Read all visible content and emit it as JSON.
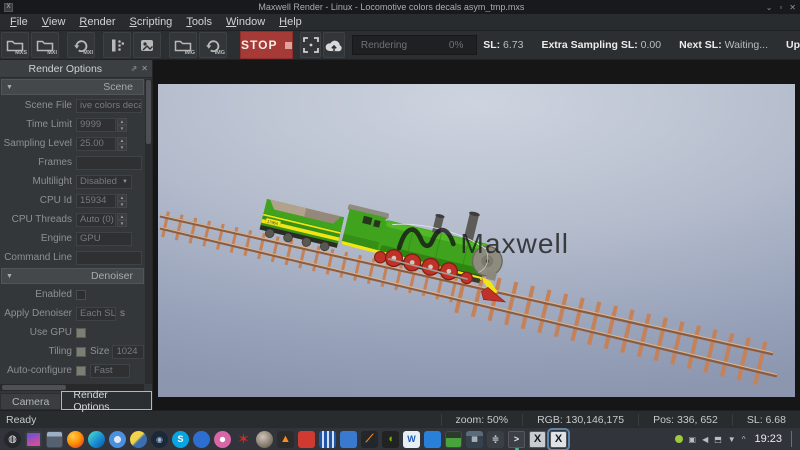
{
  "titlebar": {
    "title": "Maxwell Render - Linux - Locomotive colors decals asym_tmp.mxs",
    "minimize": "⌄",
    "maximize": "▫",
    "close": "✕"
  },
  "menubar": {
    "items": [
      "File",
      "View",
      "Render",
      "Scripting",
      "Tools",
      "Window",
      "Help"
    ]
  },
  "toolbar": {
    "open_mxs_label": "MXS",
    "open_mxi_label": "MXI",
    "resume_mxi_label": "MXI",
    "open_img_label": "IMG",
    "resume_img_label": "IMG",
    "stop_label": "STOP",
    "progress_label": "Rendering",
    "progress_value": "0%",
    "stats": [
      {
        "label": "SL:",
        "value": "6.73"
      },
      {
        "label": "Extra Sampling SL:",
        "value": "0.00"
      },
      {
        "label": "Next SL:",
        "value": "Waiting..."
      },
      {
        "label": "Up",
        "value": ""
      }
    ]
  },
  "panel": {
    "title": "Render Options",
    "scene": {
      "title": "Scene",
      "rows": [
        {
          "label": "Scene File",
          "value": "ive colors deca"
        },
        {
          "label": "Time Limit",
          "value": "9999"
        },
        {
          "label": "Sampling Level",
          "value": "25.00"
        },
        {
          "label": "Frames",
          "value": ""
        },
        {
          "label": "Multilight",
          "value": "Disabled"
        },
        {
          "label": "CPU Id",
          "value": "15934"
        },
        {
          "label": "CPU Threads",
          "value": "Auto (0)"
        },
        {
          "label": "Engine",
          "value": "GPU"
        },
        {
          "label": "Command Line",
          "value": ""
        }
      ]
    },
    "denoiser": {
      "title": "Denoiser",
      "enabled_label": "Enabled",
      "apply_label": "Apply Denoiser",
      "apply_value": "Each SL",
      "apply_truncated": "s",
      "usegpu_label": "Use GPU",
      "tiling_label": "Tiling",
      "size_label": "Size",
      "size_value": "1024",
      "autoconf_label": "Auto-configure",
      "autoconf_value": "Fast"
    },
    "tabs": [
      {
        "label": "Camera"
      },
      {
        "label": "Render Options"
      }
    ]
  },
  "viewport": {
    "watermark": "Maxwell",
    "locomotive_number": "17964"
  },
  "statusbar": {
    "ready": "Ready",
    "zoom": "zoom: 50%",
    "rgb": "RGB: 130,146,175",
    "pos": "Pos: 336, 652",
    "sl": "SL: 6.68"
  },
  "taskbar": {
    "time": "19:23",
    "glyphs": {
      "launcher": "◍",
      "steam": "◉",
      "skype": "S",
      "vlc": "▲",
      "kate": "⟋",
      "nvidia": "◖",
      "word": "W",
      "kcalc": "▦",
      "slider": "≑",
      "konsole": ">",
      "maxwell": "X",
      "star": "✶"
    }
  },
  "colors": {
    "stop_red": "#a63a36",
    "active_tab_outline": "#b7c763",
    "loco_green": "#3fa31d",
    "stripe_yellow": "#f2e513",
    "wheel_red": "#c23127",
    "track_copper": "#c58158"
  }
}
